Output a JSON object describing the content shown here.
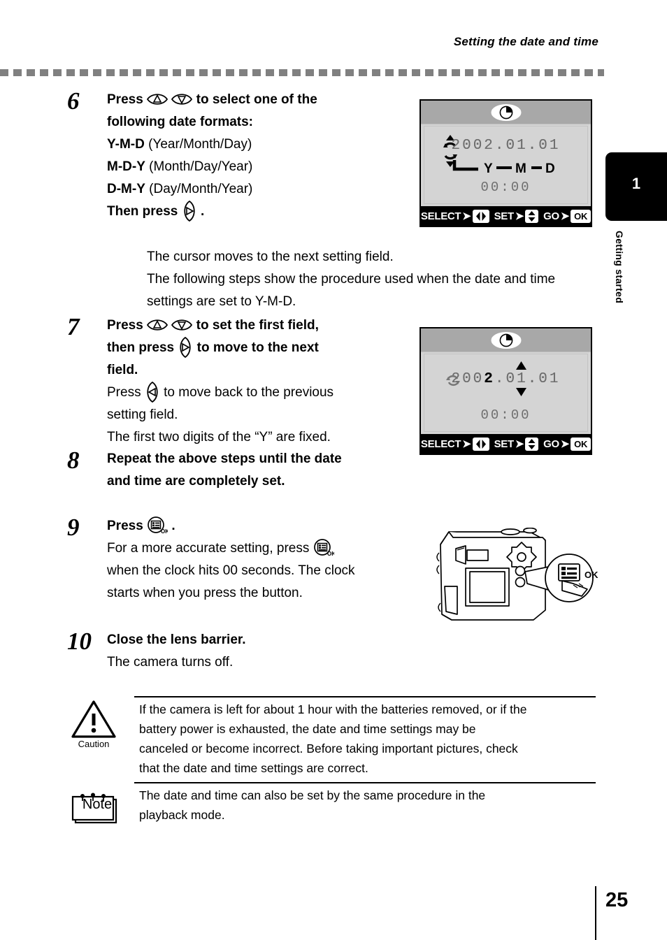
{
  "header": {
    "title": "Setting the date and time"
  },
  "chapter_tab": {
    "number": "1",
    "label": "Getting started"
  },
  "steps": [
    {
      "number": "6",
      "line1_a": "Press",
      "line1_b": "to select one of the",
      "line2": "following date formats:",
      "format1_bold": "Y-M-D",
      "format1_rest": "(Year/Month/Day)",
      "format2_bold": "M-D-Y",
      "format2_rest": "(Month/Day/Year)",
      "format3_bold": "D-M-Y",
      "format3_rest": "(Day/Month/Year)",
      "then_press": "Then press",
      "then_press_period": ".",
      "note1": "The cursor moves to the next setting field.",
      "note2": "The following steps show the procedure used when the date and time",
      "note3": "settings are set to Y-M-D."
    },
    {
      "number": "7",
      "line1_a": "Press",
      "line1_b": "to set the first field,",
      "line2_a": "then press",
      "line2_b": "to move to the next",
      "line3": "field.",
      "note1_a": "Press",
      "note1_b": "to move back to the previous",
      "note2": "setting field.",
      "note3": "The first two digits of the “Y” are fixed."
    },
    {
      "number": "8",
      "line1": "Repeat the above steps until the date",
      "line2": "and time are completely set."
    },
    {
      "number": "9",
      "line1_a": "Press",
      "line1_b": ".",
      "note1_a": "For a more accurate setting, press",
      "note2": "when the clock hits 00 seconds. The clock",
      "note3": "starts when you press the button."
    },
    {
      "number": "10",
      "line1": "Close the lens barrier.",
      "note1": "The camera turns off."
    }
  ],
  "lcd_screen_1": {
    "date": "2002.01.01",
    "ymd": "Y — M — D",
    "time": "00:00",
    "bar": {
      "select_label": "SELECT",
      "select_arrow": "➤",
      "select_chip": "left-right-pad",
      "set_label": "SET",
      "set_arrow": "➤",
      "set_chip": "up-down-pad",
      "go_label": "GO",
      "go_arrow": "➤",
      "go_chip": "OK"
    }
  },
  "lcd_screen_2": {
    "date_prefix": "200",
    "date_highlight": "2",
    "date_suffix": ".01.01",
    "time": "00:00",
    "bar": {
      "select_label": "SELECT",
      "select_arrow": "➤",
      "set_label": "SET",
      "set_arrow": "➤",
      "go_label": "GO",
      "go_arrow": "➤",
      "go_chip": "OK"
    }
  },
  "camera_callout": {
    "ok_label": "OK"
  },
  "caution": {
    "label": "Caution",
    "line1": "If the camera is left for about 1 hour with the batteries removed, or if the",
    "line2": "battery power is exhausted, the date and time settings may be",
    "line3": "canceled or become incorrect. Before taking important pictures, check",
    "line4": "that the date and time settings are correct."
  },
  "note": {
    "label": "Note",
    "line1": "The date and time can also be set by the same procedure in the",
    "line2": "playback mode."
  },
  "footer": {
    "page_number": "25"
  },
  "colors": {
    "dash_rule": "#808080",
    "lcd_bg": "#d4d4d4",
    "lcd_header": "#a8a8a8",
    "lcd_text": "#6e6e6e",
    "tab_bg": "#000000"
  }
}
